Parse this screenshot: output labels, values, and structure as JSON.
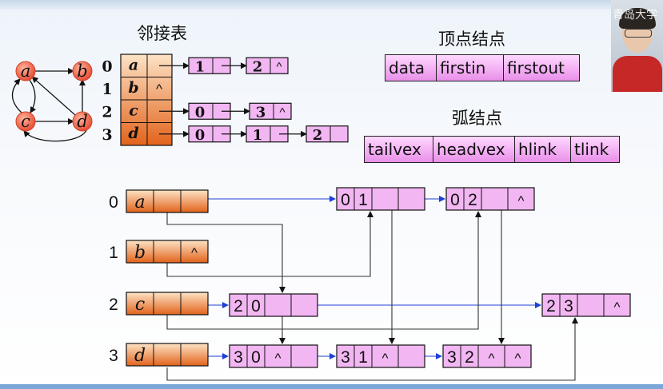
{
  "labels": {
    "adjacency_title": "邻接表",
    "vertex_node_title": "顶点结点",
    "arc_node_title": "弧结点",
    "watermark": "青岛大学"
  },
  "vertex_node_fields": [
    "data",
    "firstin",
    "firstout"
  ],
  "arc_node_fields": [
    "tailvex",
    "headvex",
    "hlink",
    "tlink"
  ],
  "graph": {
    "vertices": [
      "a",
      "b",
      "c",
      "d"
    ],
    "edges": [
      [
        "a",
        "b"
      ],
      [
        "a",
        "c"
      ],
      [
        "c",
        "a"
      ],
      [
        "c",
        "d"
      ],
      [
        "d",
        "a"
      ],
      [
        "d",
        "b"
      ],
      [
        "d",
        "c"
      ]
    ]
  },
  "adjacency_list": [
    {
      "index": "0",
      "vertex": "a",
      "nodes": [
        "1",
        "2"
      ],
      "end": "^"
    },
    {
      "index": "1",
      "vertex": "b",
      "nodes": [],
      "end": "^"
    },
    {
      "index": "2",
      "vertex": "c",
      "nodes": [
        "0",
        "3"
      ],
      "end": "^"
    },
    {
      "index": "3",
      "vertex": "d",
      "nodes": [
        "0",
        "1",
        "2"
      ],
      "end": ""
    }
  ],
  "orthogonal_list": {
    "vertices": [
      {
        "index": "0",
        "vertex": "a",
        "firstin": "",
        "firstout": ""
      },
      {
        "index": "1",
        "vertex": "b",
        "firstin": "",
        "firstout": "^"
      },
      {
        "index": "2",
        "vertex": "c",
        "firstin": "",
        "firstout": ""
      },
      {
        "index": "3",
        "vertex": "d",
        "firstin": "",
        "firstout": ""
      }
    ],
    "arcs": [
      {
        "id": "01",
        "tail": "0",
        "head": "1",
        "hlink": "",
        "tlink": ""
      },
      {
        "id": "02",
        "tail": "0",
        "head": "2",
        "hlink": "",
        "tlink": "^"
      },
      {
        "id": "20",
        "tail": "2",
        "head": "0",
        "hlink": "",
        "tlink": ""
      },
      {
        "id": "23",
        "tail": "2",
        "head": "3",
        "hlink": "",
        "tlink": "^"
      },
      {
        "id": "30",
        "tail": "3",
        "head": "0",
        "hlink": "^",
        "tlink": ""
      },
      {
        "id": "31",
        "tail": "3",
        "head": "1",
        "hlink": "^",
        "tlink": ""
      },
      {
        "id": "32",
        "tail": "3",
        "head": "2",
        "hlink": "^",
        "tlink": "^"
      }
    ]
  },
  "colors": {
    "vertex_fill_top": "#fde3c6",
    "vertex_fill_bottom": "#e2631b",
    "arc_fill": "#f2b6f2",
    "graph_node": "#ef5a3c",
    "blue_link": "#1f3fd6",
    "black_link": "#111111"
  }
}
